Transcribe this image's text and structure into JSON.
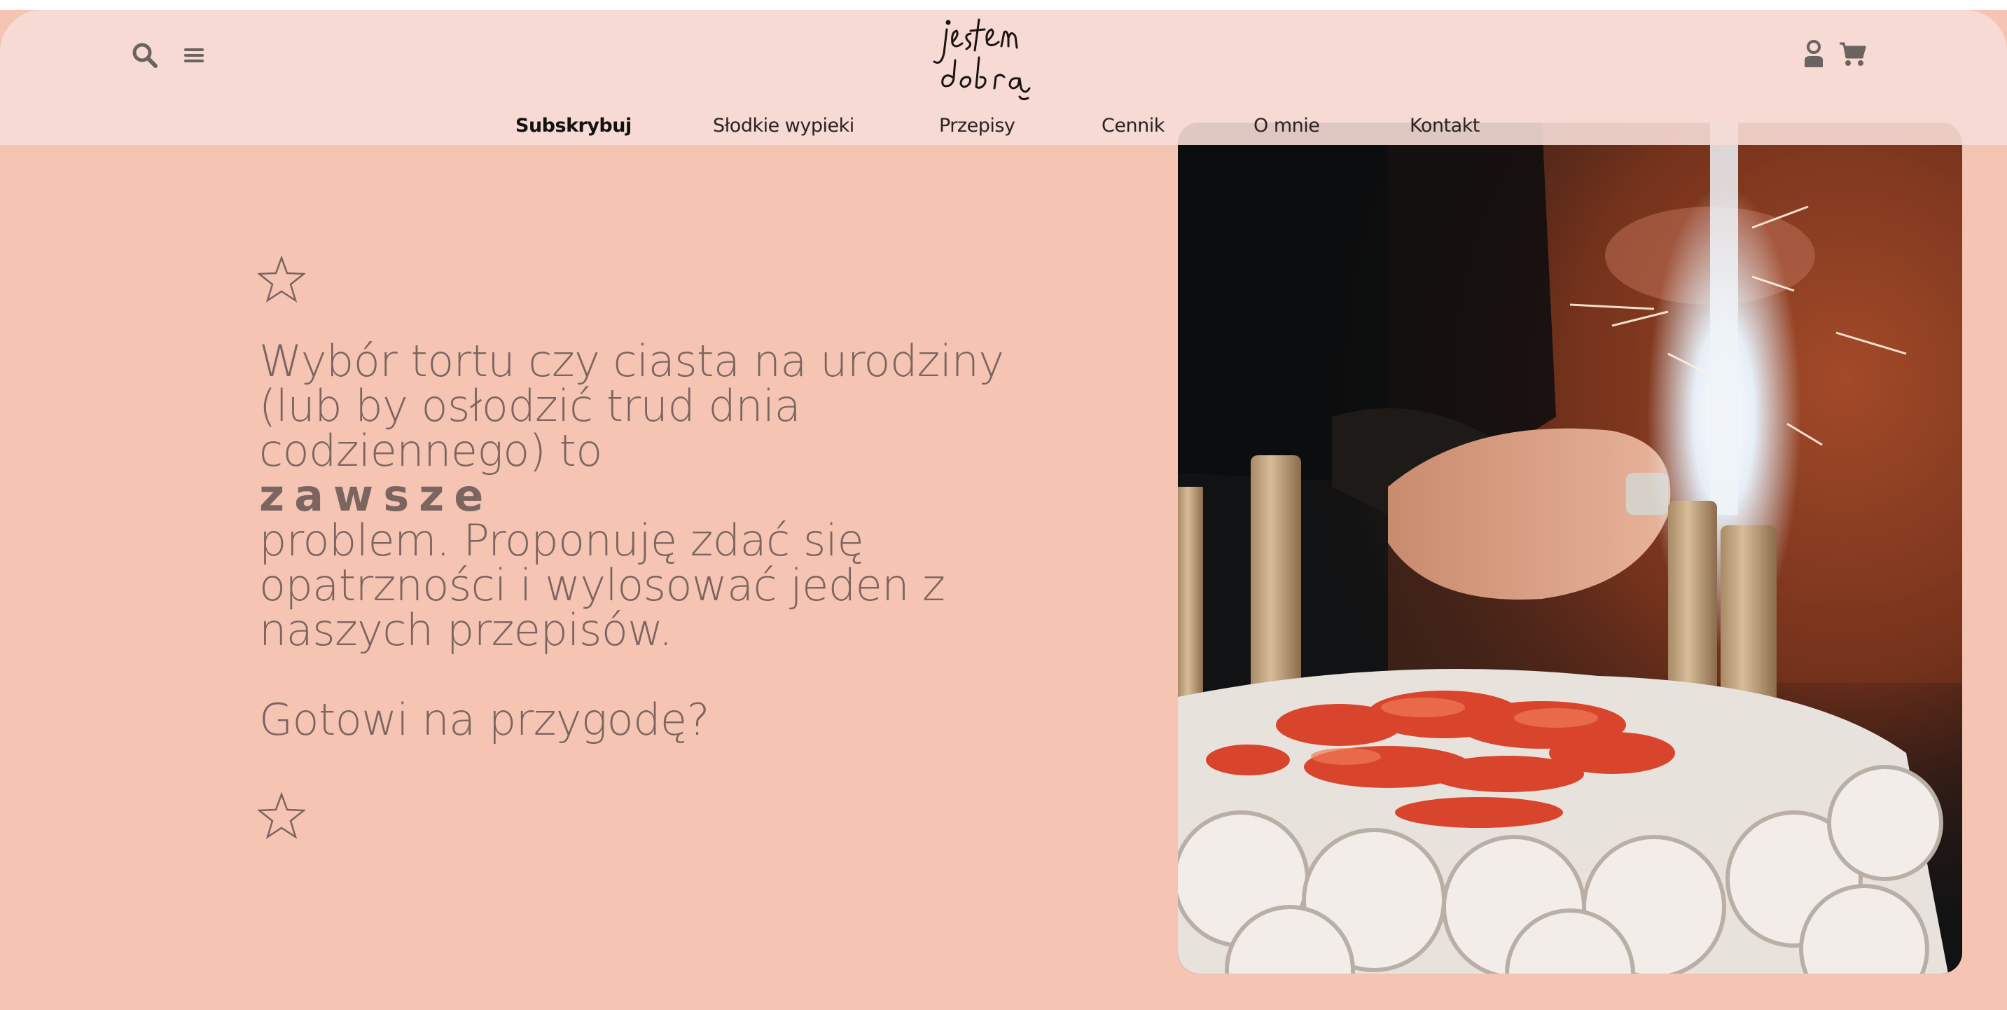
{
  "header": {
    "logo_text": "jestem dobra",
    "icons": {
      "search": "search-icon",
      "menu": "hamburger-menu-icon",
      "account": "user-icon",
      "cart": "cart-icon"
    },
    "nav": [
      {
        "label": "Subskrybuj",
        "active": true
      },
      {
        "label": "Słodkie wypieki",
        "active": false
      },
      {
        "label": "Przepisy",
        "active": false
      },
      {
        "label": "Cennik",
        "active": false
      },
      {
        "label": "O mnie",
        "active": false
      },
      {
        "label": "Kontakt",
        "active": false
      }
    ]
  },
  "hero": {
    "star_icon": "star-outline-icon",
    "lines": [
      "Wybór tortu czy ciasta na urodziny",
      "(lub by osłodzić trud dnia",
      "codziennego) to"
    ],
    "emphasis": "zawsze",
    "lines_after": [
      "problem. Proponuję zdać się",
      "opatrzności i wylosować jeden z",
      "naszych przepisów."
    ],
    "closing": "Gotowi na przygodę?",
    "image_subject": "birthday-cake-with-sparkler"
  },
  "colors": {
    "background": "#f5c4b3",
    "header": "#f6ddd6",
    "text": "#7a6560",
    "nav_text": "#2a2222"
  }
}
